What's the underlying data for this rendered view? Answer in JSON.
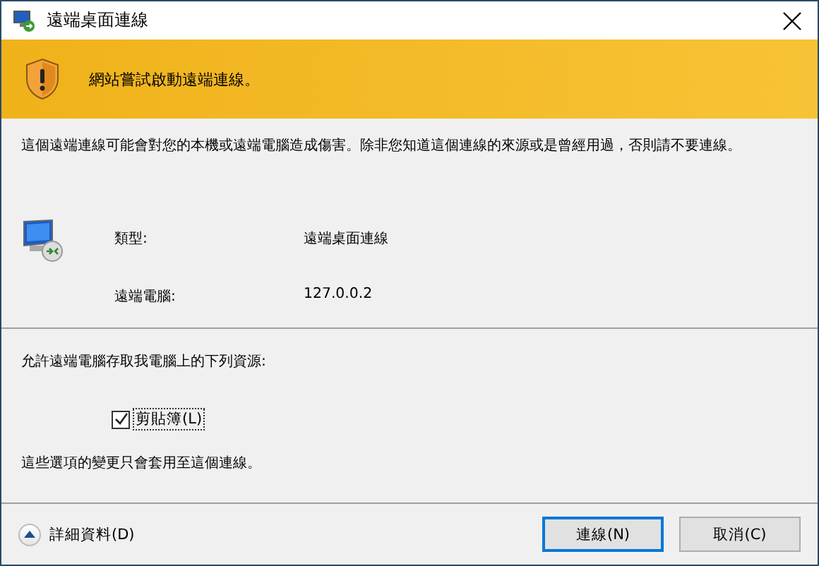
{
  "window": {
    "title": "遠端桌面連線"
  },
  "banner": {
    "message": "網站嘗試啟動遠端連線。"
  },
  "warning": "這個遠端連線可能會對您的本機或遠端電腦造成傷害。除非您知道這個連線的來源或是曾經用過，否則請不要連線。",
  "details": [
    {
      "label": "類型:",
      "value": "遠端桌面連線"
    },
    {
      "label": "遠端電腦:",
      "value": "127.0.0.2"
    }
  ],
  "resources": {
    "prompt": "允許遠端電腦存取我電腦上的下列資源:",
    "options": [
      {
        "label": "剪貼簿(L)",
        "checked": true
      }
    ],
    "note": "這些選項的變更只會套用至這個連線。"
  },
  "details_toggle": {
    "label": "詳細資料(D)",
    "expanded": false
  },
  "buttons": [
    {
      "label": "連線(N)",
      "default": true
    },
    {
      "label": "取消(C)",
      "default": false
    }
  ]
}
